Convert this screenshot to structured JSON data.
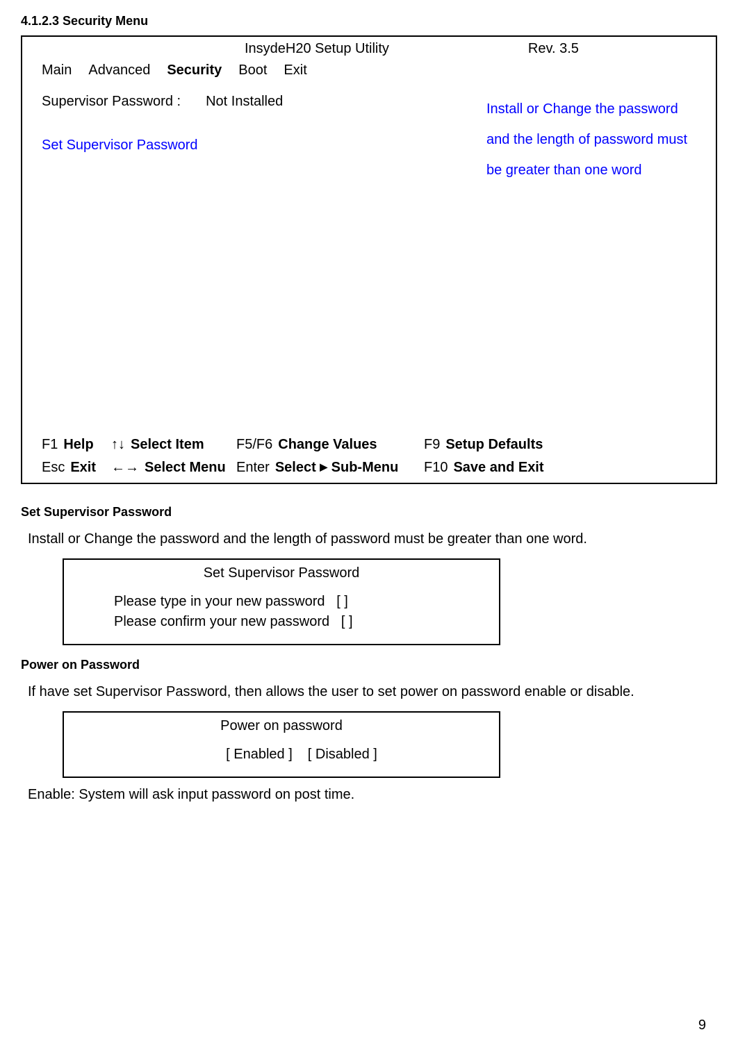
{
  "doc": {
    "section_number": "4.1.2.3 Security Menu",
    "page_number": "9"
  },
  "bios": {
    "title": "InsydeH20 Setup Utility",
    "rev": "Rev. 3.5",
    "tabs": {
      "main": "Main",
      "advanced": "Advanced",
      "security": "Security",
      "boot": "Boot",
      "exit": "Exit"
    },
    "supervisor_label": "Supervisor Password :",
    "supervisor_value": "Not Installed",
    "set_supervisor": "Set Supervisor Password",
    "help_text": "Install or Change the password and the length of password must be greater than one word",
    "footer": {
      "f1": {
        "key": "F1",
        "label": "Help"
      },
      "updown": {
        "key": "↑↓",
        "label": "Select Item"
      },
      "f5f6": {
        "key": "F5/F6",
        "label": "Change Values"
      },
      "f9": {
        "key": "F9",
        "label": "Setup Defaults"
      },
      "esc": {
        "key": "Esc",
        "label": "Exit"
      },
      "leftright": {
        "key": "←→",
        "label": "Select Menu"
      },
      "enter": {
        "key": "Enter",
        "label_prefix": "Select",
        "label_suffix": "Sub-Menu"
      },
      "f10": {
        "key": "F10",
        "label": "Save and Exit"
      }
    }
  },
  "sections": {
    "set_supervisor": {
      "heading": "Set Supervisor Password",
      "description": "Install or Change the password and the length of password must be greater than one word.",
      "dialog_title": "Set Supervisor Password",
      "row1_label": "Please type in your new password",
      "row1_value": "[     ]",
      "row2_label": "Please confirm your new password",
      "row2_value": "[     ]"
    },
    "power_on": {
      "heading": "Power on Password",
      "description": "If have set Supervisor Password, then allows the user to set power on password enable or disable.",
      "dialog_title": "Power on password",
      "option_enabled": "[ Enabled ]",
      "option_disabled": "[ Disabled ]",
      "note": "Enable: System will ask input password on post time."
    }
  }
}
